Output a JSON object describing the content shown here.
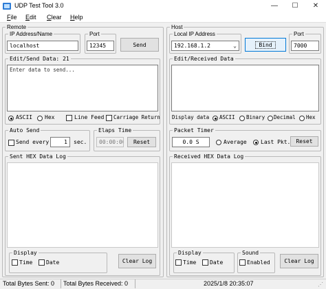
{
  "window": {
    "title": "UDP Test Tool 3.0"
  },
  "menu": {
    "file": "File",
    "file_key": "F",
    "file_rest": "ile",
    "edit": "Edit",
    "edit_key": "E",
    "edit_rest": "dit",
    "clear": "Clear",
    "clear_key": "C",
    "clear_rest": "lear",
    "help": "Help",
    "help_key": "H",
    "help_rest": "elp"
  },
  "remote": {
    "group_label": "Remote",
    "ip_label": "IP Address/Name",
    "ip_value": "localhost",
    "port_label": "Port",
    "port_value": "12345",
    "send_button": "Send",
    "edit_send_label": "Edit/Send Data: 21",
    "send_placeholder": "Enter data to send...",
    "format_ascii": "ASCII",
    "format_hex": "Hex",
    "line_feed": "Line Feed",
    "carriage_return": "Carriage Return",
    "auto_send_label": "Auto Send",
    "send_every": "Send every",
    "interval_value": "1",
    "interval_unit": "sec.",
    "elaps_label": "Elaps Time",
    "elaps_value": "00:00:00",
    "reset_button": "Reset",
    "log_label": "Sent HEX Data Log",
    "display_label": "Display",
    "display_time": "Time",
    "display_date": "Date",
    "clear_log_button": "Clear Log"
  },
  "host": {
    "group_label": "Host",
    "local_ip_label": "Local IP Address",
    "local_ip_value": "192.168.1.2",
    "port_label": "Port",
    "port_value": "7000",
    "bind_button": "Bind",
    "edit_received_label": "Edit/Received Data",
    "display_data_label": "Display data",
    "format_ascii": "ASCII",
    "format_binary": "Binary",
    "format_decimal": "Decimal",
    "format_hex": "Hex",
    "packet_timer_label": "Packet Timer",
    "packet_timer_value": "0.0 S",
    "average": "Average",
    "last_pkt": "Last Pkt.",
    "reset_button": "Reset",
    "log_label": "Received HEX Data Log",
    "display_label": "Display",
    "display_time": "Time",
    "display_date": "Date",
    "sound_label": "Sound",
    "sound_enabled": "Enabled",
    "clear_log_button": "Clear Log"
  },
  "status": {
    "bytes_sent": "Total Bytes Sent: 0",
    "bytes_received": "Total Bytes Received: 0",
    "datetime": "2025/1/8 20:35:07"
  },
  "colors": {
    "accent": "#0078d7",
    "titlebar": "#ffffff",
    "window_bg": "#f0f0f0"
  }
}
